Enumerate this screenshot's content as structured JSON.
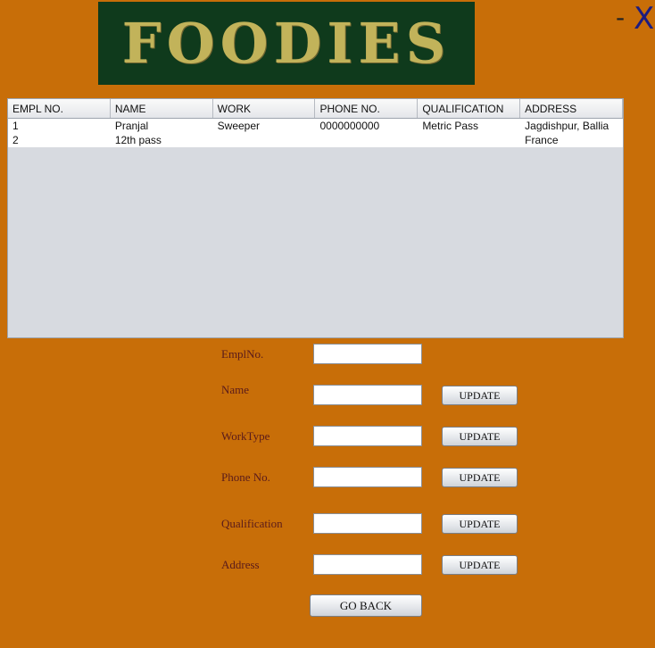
{
  "header": {
    "logo_text": "FOODIES",
    "minimize_label": "-",
    "close_label": "X"
  },
  "table": {
    "columns": [
      "EMPL NO.",
      "NAME",
      "WORK",
      "PHONE NO.",
      "QUALIFICATION",
      "ADDRESS"
    ],
    "rows": [
      [
        "1",
        "Pranjal",
        "Sweeper",
        "0000000000",
        "Metric Pass",
        "Jagdishpur, Ballia"
      ],
      [
        "2",
        "12th pass",
        "",
        "",
        "",
        "France"
      ]
    ]
  },
  "form": {
    "empl_no": {
      "label": "EmplNo.",
      "value": ""
    },
    "name": {
      "label": "Name",
      "value": "",
      "button": "UPDATE"
    },
    "work_type": {
      "label": "WorkType",
      "value": "",
      "button": "UPDATE"
    },
    "phone_no": {
      "label": "Phone No.",
      "value": "",
      "button": "UPDATE"
    },
    "qualification": {
      "label": "Qualification",
      "value": "",
      "button": "UPDATE"
    },
    "address": {
      "label": "Address",
      "value": "",
      "button": "UPDATE"
    },
    "go_back": "GO BACK"
  }
}
